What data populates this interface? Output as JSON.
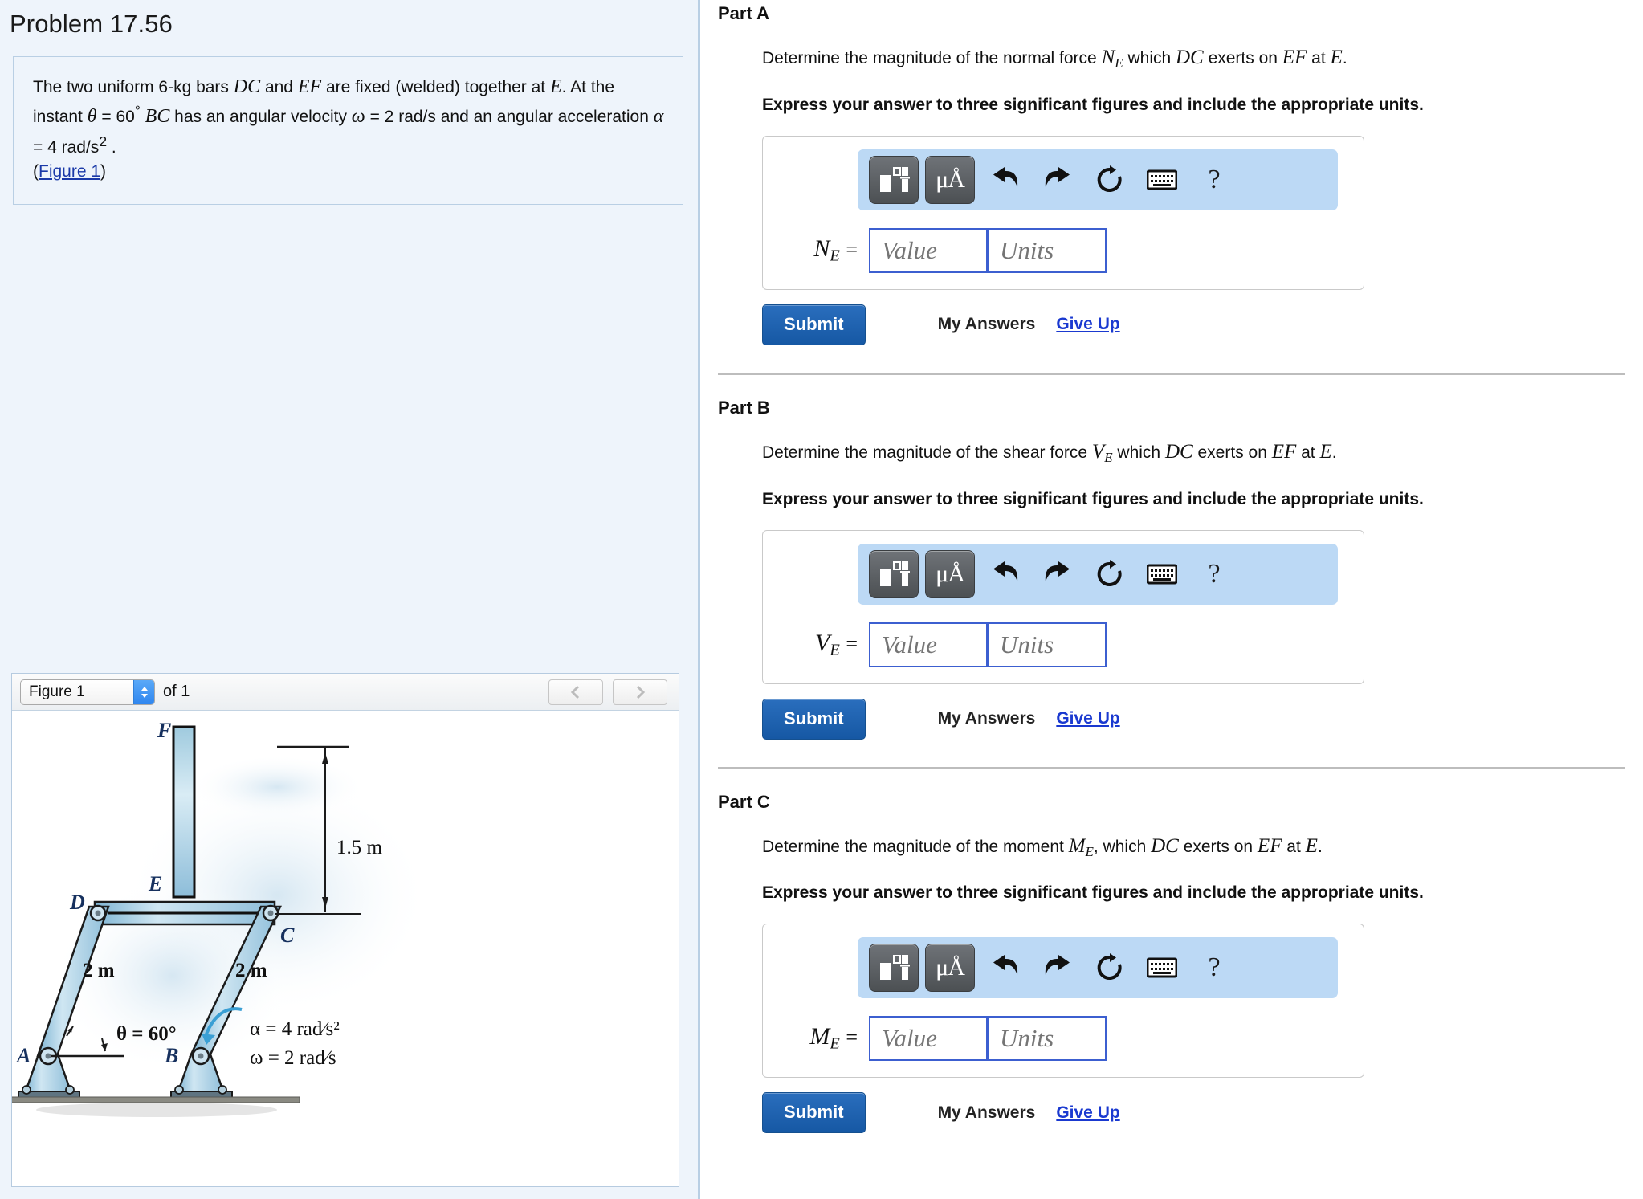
{
  "problem": {
    "title": "Problem 17.56",
    "statement_html": "The two uniform 6-kg bars <i class='mathit'>DC</i> and <i class='mathit'>EF</i> are fixed (welded) together at <i class='mathit'>E</i>. At the instant <i class='mathit'>&theta;</i> = 60<sup>&deg;</sup> <i class='mathit'>BC</i> has an angular velocity <i class='mathit'>&omega;</i> = 2 rad/s and an angular acceleration <i class='mathit'>&alpha;</i> = 4 rad/s<sup>2</sup> .",
    "figure_link_text": "Figure 1",
    "figure_link_prefix": "(",
    "figure_link_suffix": ")"
  },
  "figure_panel": {
    "selected_figure": "Figure 1",
    "of_label": "of 1",
    "prev_icon": "chevron-left-icon",
    "next_icon": "chevron-right-icon",
    "labels": {
      "F": "F",
      "E": "E",
      "D": "D",
      "C": "C",
      "A": "A",
      "B": "B",
      "height_dim": "1.5 m",
      "left_bar_len": "2 m",
      "right_bar_len": "2 m",
      "theta": "θ = 60°",
      "alpha": "α = 4 rad/s²",
      "omega": "ω = 2 rad/s"
    }
  },
  "toolbar": {
    "template_icon": "math-template-icon",
    "units_icon": "micro-angstrom-units-icon",
    "undo_icon": "undo-icon",
    "redo_icon": "redo-icon",
    "reset_icon": "reset-icon",
    "keyboard_icon": "keyboard-icon",
    "help_icon": "question-mark-icon"
  },
  "common": {
    "value_placeholder": "Value",
    "units_placeholder": "Units",
    "submit_label": "Submit",
    "my_answers_label": "My Answers",
    "give_up_label": "Give Up",
    "instruction": "Express your answer to three significant figures and include the appropriate units."
  },
  "parts": [
    {
      "id": "A",
      "title": "Part A",
      "question_prefix": "Determine the magnitude of the normal force ",
      "question_var": "N",
      "question_var_sub": "E",
      "question_mid": " which ",
      "question_body1": "DC",
      "question_mid2": " exerts on ",
      "question_body2": "EF",
      "question_suffix": " at ",
      "question_end": "E",
      "question_period": ".",
      "var_symbol": "N",
      "var_sub": "E",
      "var_eq": "="
    },
    {
      "id": "B",
      "title": "Part B",
      "question_prefix": "Determine the magnitude of the shear force ",
      "question_var": "V",
      "question_var_sub": "E",
      "question_mid": " which ",
      "question_body1": "DC",
      "question_mid2": " exerts on ",
      "question_body2": "EF",
      "question_suffix": " at ",
      "question_end": "E",
      "question_period": ".",
      "var_symbol": "V",
      "var_sub": "E",
      "var_eq": "="
    },
    {
      "id": "C",
      "title": "Part C",
      "question_prefix": "Determine the magnitude of the moment ",
      "question_var": "M",
      "question_var_sub": "E",
      "question_mid": ", which ",
      "question_body1": "DC",
      "question_mid2": " exerts on ",
      "question_body2": "EF",
      "question_suffix": " at ",
      "question_end": "E",
      "question_period": ".",
      "var_symbol": "M",
      "var_sub": "E",
      "var_eq": "="
    }
  ],
  "colors": {
    "panel_bg": "#eef4fb",
    "panel_border": "#b9cfe4",
    "submit_blue": "#1658a4",
    "link_blue": "#1a39d0",
    "toolbar_blue": "#bcd9f5",
    "input_border": "#3c5fd0",
    "bar_fill": "#a8cde4"
  }
}
